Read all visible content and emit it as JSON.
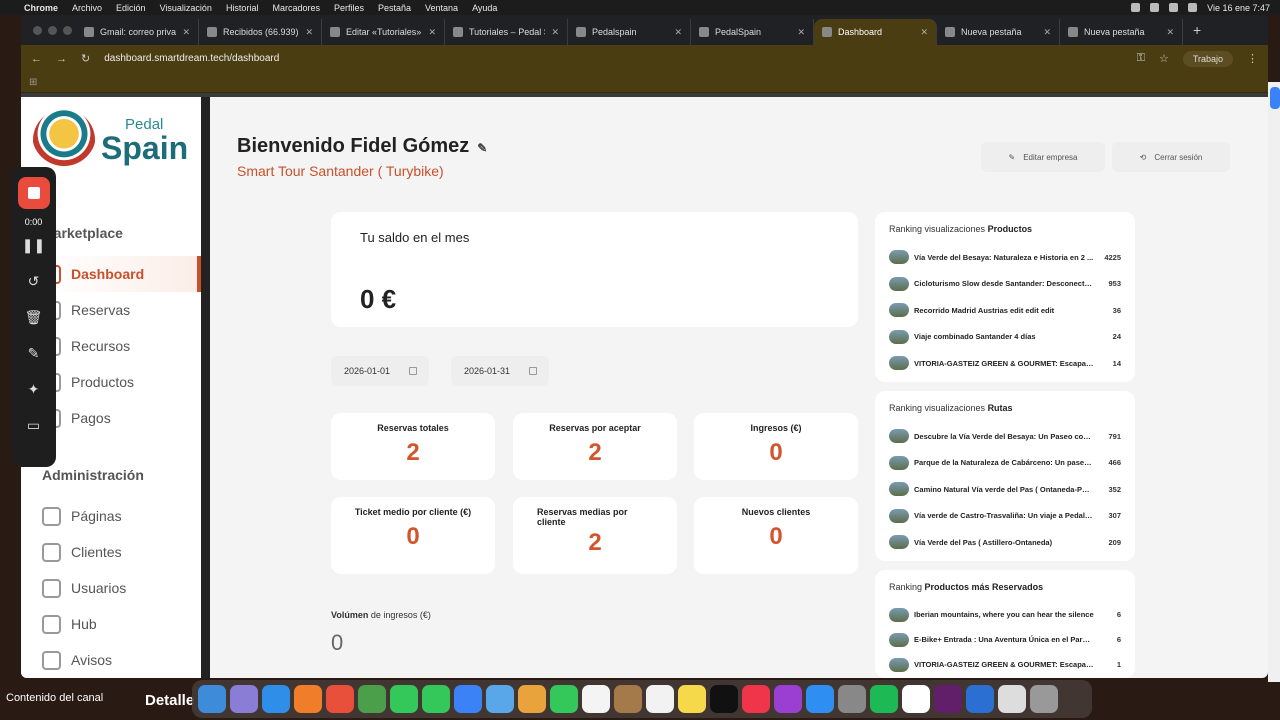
{
  "menubar": {
    "app": "Chrome",
    "items": [
      "Archivo",
      "Edición",
      "Visualización",
      "Historial",
      "Marcadores",
      "Perfiles",
      "Pestaña",
      "Ventana",
      "Ayuda"
    ],
    "clock": "Vie 16 ene 7:47"
  },
  "browser": {
    "tabs": [
      {
        "title": "Gmail: correo privad"
      },
      {
        "title": "Recibidos (66.939)"
      },
      {
        "title": "Editar «Tutoriales» ‹"
      },
      {
        "title": "Tutoriales – Pedal S"
      },
      {
        "title": "Pedalspain"
      },
      {
        "title": "PedalSpain"
      },
      {
        "title": "Dashboard"
      },
      {
        "title": "Nueva pestaña"
      },
      {
        "title": "Nueva pestaña"
      }
    ],
    "url": "dashboard.smartdream.tech/dashboard",
    "profile": "Trabajo"
  },
  "sidebar": {
    "logo_top": "Pedal",
    "logo_bottom": "Spain",
    "section1": "Marketplace",
    "items1": [
      "Dashboard",
      "Reservas",
      "Recursos",
      "Productos",
      "Pagos"
    ],
    "section2": "Administración",
    "items2": [
      "Páginas",
      "Clientes",
      "Usuarios",
      "Hub",
      "Avisos"
    ]
  },
  "header": {
    "welcome": "Bienvenido Fidel Gómez",
    "company": "Smart Tour Santander ( Turybike)",
    "edit_company": "Editar empresa",
    "logout": "Cerrar sesión"
  },
  "balance": {
    "label": "Tu saldo en el mes",
    "value": "0 €"
  },
  "dates": {
    "start": "2026-01-01",
    "end": "2026-01-31"
  },
  "stats": [
    {
      "label": "Reservas totales",
      "value": "2"
    },
    {
      "label": "Reservas por aceptar",
      "value": "2"
    },
    {
      "label": "Ingresos (€)",
      "value": "0"
    },
    {
      "label": "Ticket medio por cliente (€)",
      "value": "0"
    },
    {
      "label": "Reservas medias por cliente",
      "value": "2"
    },
    {
      "label": "Nuevos clientes",
      "value": "0"
    }
  ],
  "volume": {
    "label_bold": "Volúmen",
    "label_rest": " de ingresos (€)",
    "value": "0"
  },
  "rankings": [
    {
      "title_pre": "Ranking visualizaciones ",
      "title_bold": "Productos",
      "items": [
        {
          "name": "Vía Verde del Besaya: Naturaleza e Historia en 2 ...",
          "count": "4225"
        },
        {
          "name": "Cicloturismo Slow desde Santander: Desconecta, ...",
          "count": "953"
        },
        {
          "name": "Recorrido Madrid Austrias edit edit edit",
          "count": "36"
        },
        {
          "name": "Viaje combinado Santander 4 días",
          "count": "24"
        },
        {
          "name": "VITORIA-GASTEIZ GREEN & GOURMET: Escapada S...",
          "count": "14"
        }
      ]
    },
    {
      "title_pre": "Ranking visualizaciones ",
      "title_bold": "Rutas",
      "items": [
        {
          "name": "Descubre la Vía Verde del Besaya: Un Paseo con E...",
          "count": "791"
        },
        {
          "name": "Parque de la Naturaleza de Cabárceno: Un paseo e...",
          "count": "466"
        },
        {
          "name": "Camino Natural Vía verde del Pas ( Ontaneda-Pue...",
          "count": "352"
        },
        {
          "name": "Vía verde de Castro-Trasvaliña: Un viaje a Pedales ...",
          "count": "307"
        },
        {
          "name": "Vía Verde del Pas ( Astillero-Ontaneda)",
          "count": "209"
        }
      ]
    },
    {
      "title_pre": "Ranking ",
      "title_bold": "Productos más Reservados",
      "items": [
        {
          "name": "Iberian mountains, where you can hear the silence",
          "count": "6"
        },
        {
          "name": "E-Bike+ Entrada : Una Aventura Única en el Parque d...",
          "count": "6"
        },
        {
          "name": "VITORIA-GASTEIZ GREEN & GOURMET: Escapada Sl...",
          "count": "1"
        }
      ]
    }
  ],
  "recorder": {
    "time": "0:00"
  },
  "desktop": {
    "channel": "Contenido del canal",
    "detail": "Detalle"
  }
}
